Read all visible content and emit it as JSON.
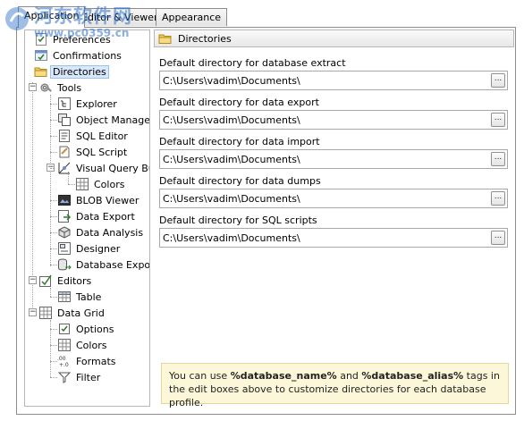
{
  "tabs": [
    {
      "label": "Application",
      "active": true
    },
    {
      "label": "Editor & Viewers",
      "active": false
    },
    {
      "label": "Appearance",
      "active": false
    }
  ],
  "watermark": {
    "title": "河东软件网",
    "url": "www.pc0359.cn"
  },
  "tree": {
    "preferences": "Preferences",
    "confirmations": "Confirmations",
    "directories": "Directories",
    "tools": "Tools",
    "explorer": "Explorer",
    "object_manager": "Object Manager",
    "sql_editor": "SQL Editor",
    "sql_script": "SQL Script",
    "visual_query_builder": "Visual Query Buil",
    "colors": "Colors",
    "blob_viewer": "BLOB Viewer",
    "data_export": "Data Export",
    "data_analysis": "Data Analysis",
    "designer": "Designer",
    "database_export": "Database Export",
    "editors": "Editors",
    "table": "Table",
    "data_grid": "Data Grid",
    "options": "Options",
    "grid_colors": "Colors",
    "formats": "Formats",
    "filter": "Filter"
  },
  "section": {
    "title": "Directories"
  },
  "fields": [
    {
      "label": "Default directory for database extract",
      "value": "C:\\Users\\vadim\\Documents\\"
    },
    {
      "label": "Default directory for data export",
      "value": "C:\\Users\\vadim\\Documents\\"
    },
    {
      "label": "Default directory for data import",
      "value": "C:\\Users\\vadim\\Documents\\"
    },
    {
      "label": "Default directory for data dumps",
      "value": "C:\\Users\\vadim\\Documents\\"
    },
    {
      "label": "Default directory for SQL scripts",
      "value": "C:\\Users\\vadim\\Documents\\"
    }
  ],
  "browse_label": "...",
  "hint": {
    "prefix": "You can use ",
    "tag1": "%database_name%",
    "middle": " and ",
    "tag2": "%database_alias%",
    "suffix": " tags in the edit boxes above to customize directories for each database profile."
  },
  "colors": {
    "selection": "#d9e8fb",
    "hint_bg": "#fdf7d9",
    "folder": "#f2cb5a"
  }
}
